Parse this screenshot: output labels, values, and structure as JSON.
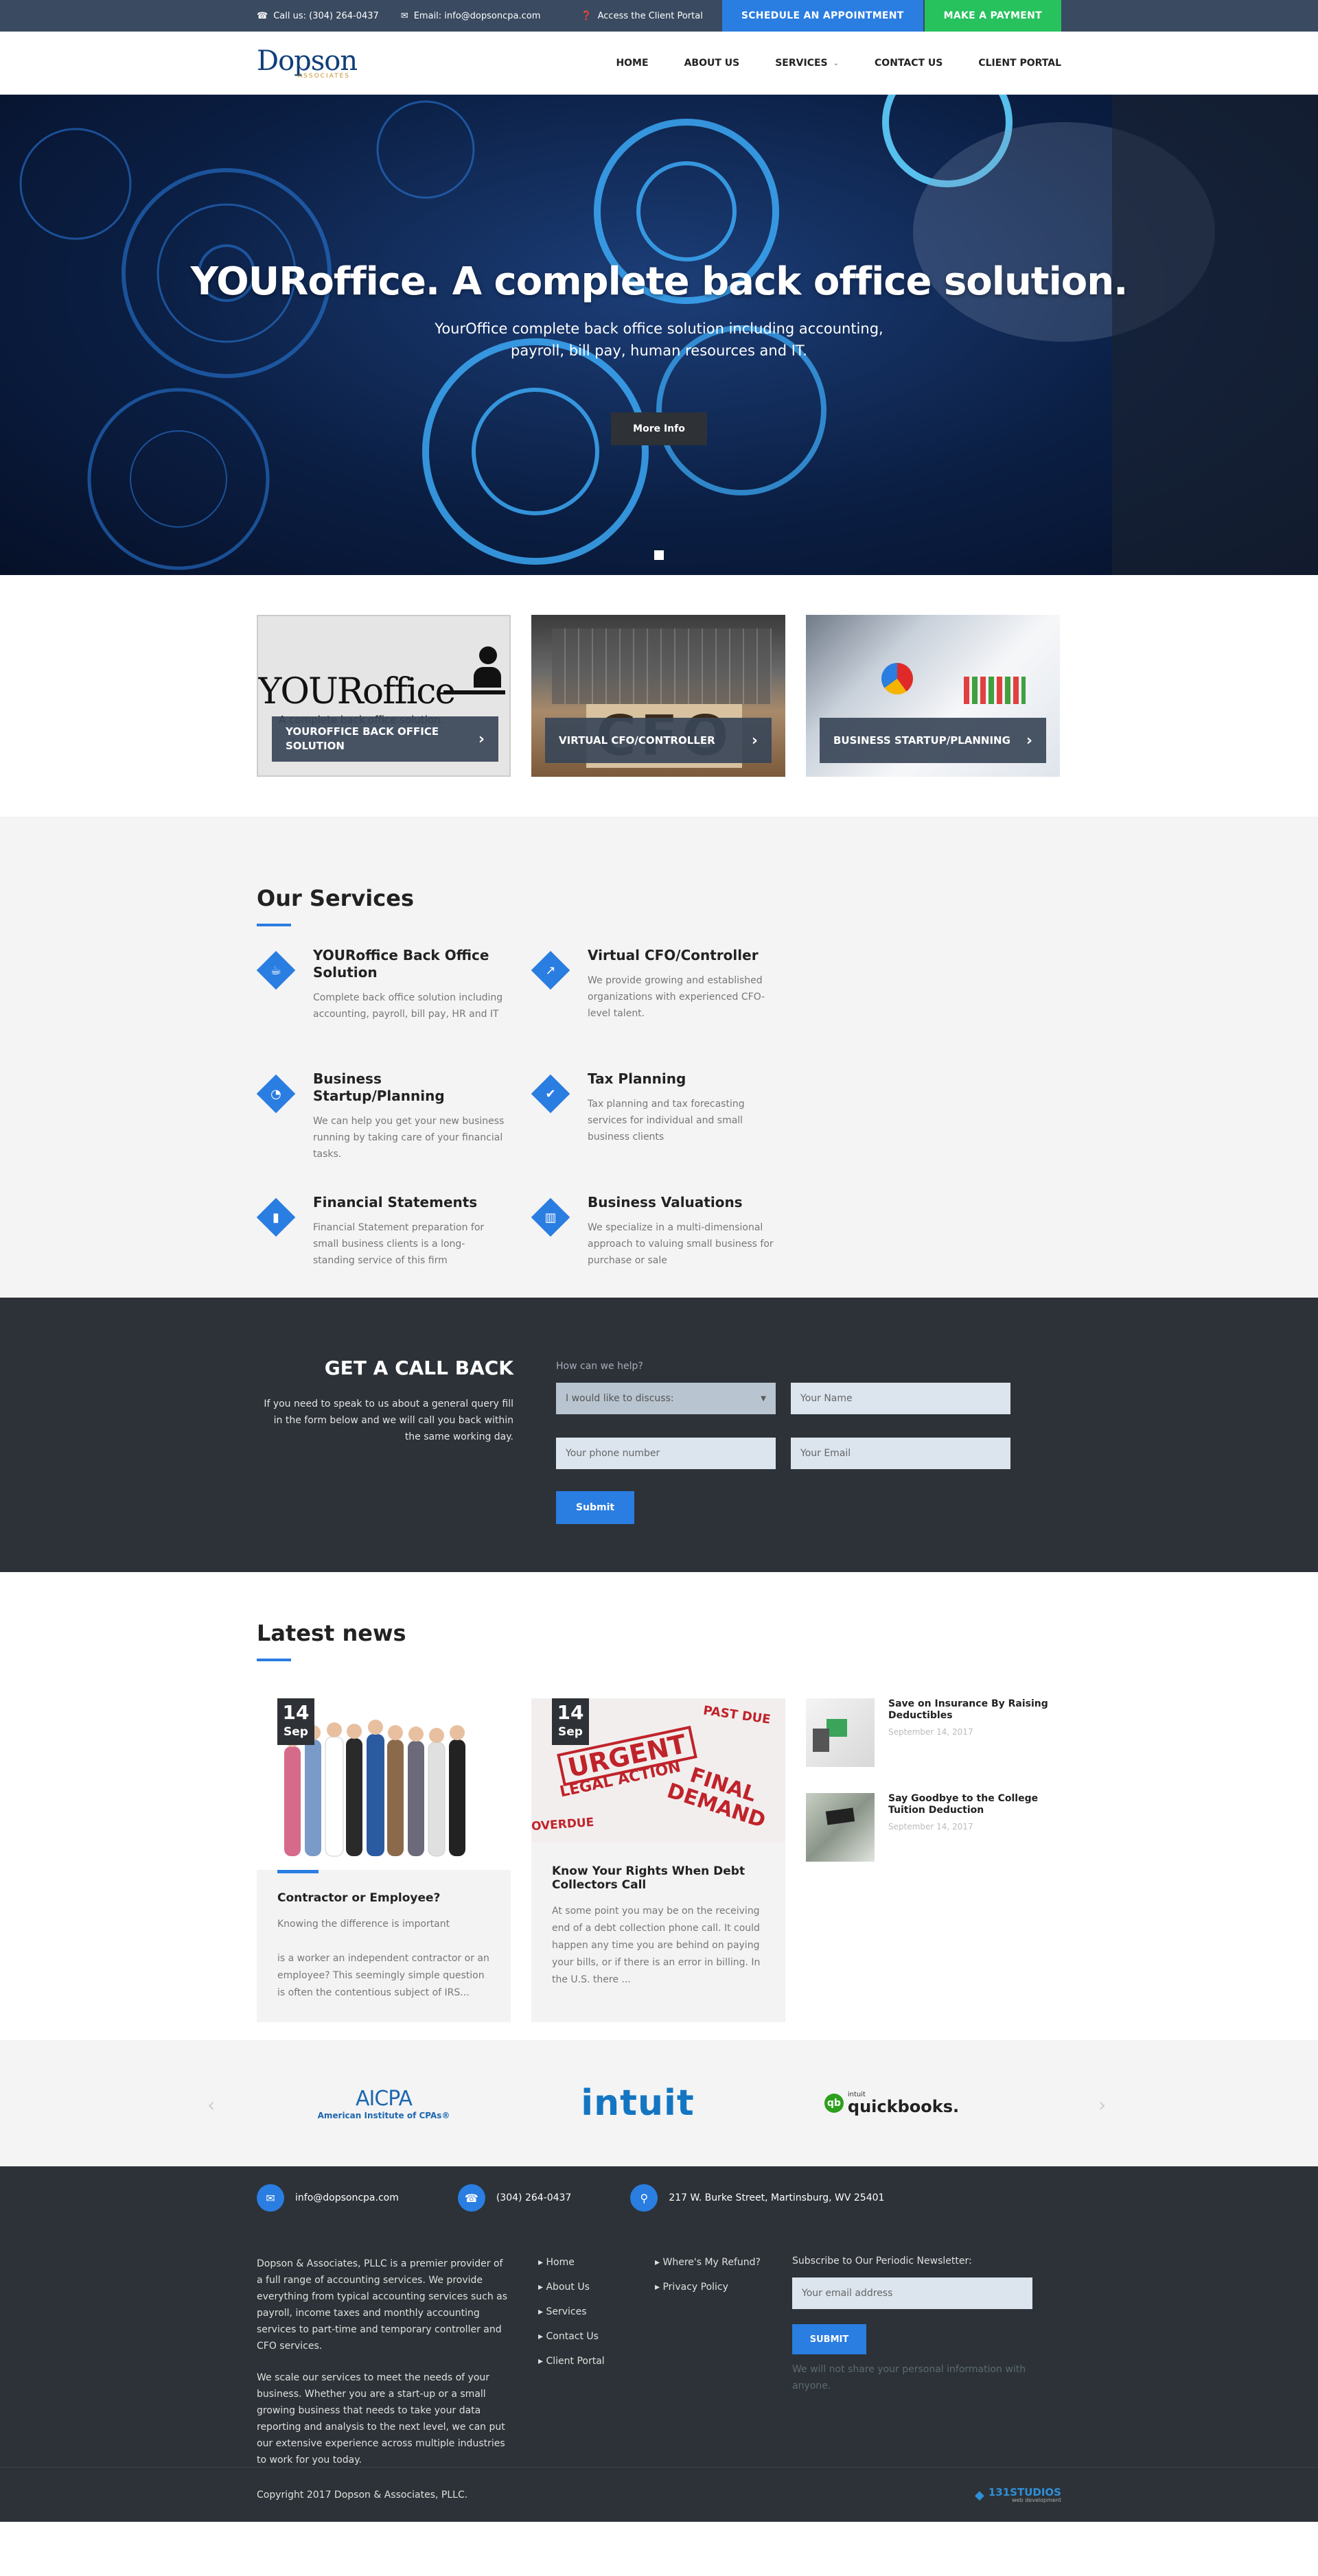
{
  "topbar": {
    "call": "Call us: (304) 264-0437",
    "email": "Email: info@dopsoncpa.com",
    "portal": "Access the Client Portal",
    "schedule": "SCHEDULE AN APPOINTMENT",
    "payment": "MAKE A PAYMENT"
  },
  "logo": {
    "main": "Dopson",
    "sub": "ASSOCIATES"
  },
  "nav": {
    "home": "HOME",
    "about": "ABOUT US",
    "services": "SERVICES",
    "contact": "CONTACT US",
    "portal": "CLIENT PORTAL"
  },
  "hero": {
    "title": "YOURoffice. A complete back office solution.",
    "subtitle": "YourOffice complete back office solution including accounting, payroll, bill pay, human resources and IT.",
    "button": "More Info"
  },
  "cards": [
    {
      "label": "YOUROFFICE BACK OFFICE SOLUTION",
      "img_title": "YOURoffice",
      "img_sub": "A complete back office solution."
    },
    {
      "label": "VIRTUAL CFO/CONTROLLER",
      "img_text": "CFO"
    },
    {
      "label": "BUSINESS STARTUP/PLANNING"
    }
  ],
  "services": {
    "title": "Our Services",
    "items": [
      {
        "title": "YOURoffice Back Office Solution",
        "desc": "Complete back office solution including accounting, payroll, bill pay, HR and IT",
        "icon": "coffee-icon",
        "glyph": "☕"
      },
      {
        "title": "Virtual CFO/Controller",
        "desc": "We provide growing and established organizations with experienced CFO-level talent.",
        "icon": "trending-up-icon",
        "glyph": "↗"
      },
      {
        "title": "Business Startup/Planning",
        "desc": "We can help you get your new business running by taking care of your financial tasks.",
        "icon": "pie-chart-icon",
        "glyph": "◔"
      },
      {
        "title": "Tax Planning",
        "desc": "Tax planning and tax forecasting services for individual and small business clients",
        "icon": "check-circle-icon",
        "glyph": "✔"
      },
      {
        "title": "Financial Statements",
        "desc": "Financial Statement preparation for small business clients is a long-standing service of this firm",
        "icon": "bar-chart-icon",
        "glyph": "▮"
      },
      {
        "title": "Business Valuations",
        "desc": "We specialize in a multi-dimensional approach to valuing small business for purchase or sale",
        "icon": "column-chart-icon",
        "glyph": "▥"
      }
    ]
  },
  "callback": {
    "title": "GET A CALL BACK",
    "text": "If you need to speak to us about a general query fill in the form below and we will call you back within the same working day.",
    "label": "How can we help?",
    "select": "I would like to discuss:",
    "name": "Your Name",
    "phone": "Your phone number",
    "email": "Your Email",
    "submit": "Submit"
  },
  "news": {
    "title": "Latest news",
    "posts": [
      {
        "day": "14",
        "month": "Sep",
        "title": "Contractor or Employee?",
        "text": "Knowing the difference is important\n\nis a worker an independent contractor or an employee? This seemingly simple question is often the contentious subject of IRS..."
      },
      {
        "day": "14",
        "month": "Sep",
        "title": "Know Your Rights When Debt Collectors Call",
        "text": "At some point you may be on the receiving end of a debt collection phone call. It could happen any time you are behind on paying your bills, or if there is an error in billing. In the U.S. there ..."
      }
    ],
    "image_words": [
      "URGENT",
      "LEGAL ACTION",
      "FINAL",
      "DEMAND",
      "PAST DUE",
      "OVERDUE"
    ],
    "side": [
      {
        "title": "Save on Insurance By Raising Deductibles",
        "date": "September 14, 2017"
      },
      {
        "title": "Say Goodbye to the College Tuition Deduction",
        "date": "September 14, 2017"
      }
    ]
  },
  "partners": {
    "aicpa": "AICPA",
    "aicpa_sub": "American Institute of CPAs®",
    "intuit": "intuit",
    "qb_small": "intuit",
    "qb": "quickbooks."
  },
  "footer": {
    "email": "info@dopsoncpa.com",
    "phone": "(304) 264-0437",
    "address": "217 W. Burke Street, Martinsburg, WV 25401",
    "about1": "Dopson & Associates, PLLC is a premier provider of a full range of accounting services. We provide everything from typical accounting services such as payroll, income taxes and monthly accounting services to part-time and temporary controller and CFO services.",
    "about2": "We scale our services to meet the needs of your business. Whether you are a start-up or a small growing business that needs to take your data reporting and analysis to the next level, we can put our extensive experience across multiple industries to work for you today.",
    "links": [
      "Home",
      "About Us",
      "Services",
      "Contact Us",
      "Client Portal"
    ],
    "links2": [
      "Where's My Refund?",
      "Privacy Policy"
    ],
    "newsletter_label": "Subscribe to Our Periodic Newsletter:",
    "newsletter_placeholder": "Your email address",
    "newsletter_button": "SUBMIT",
    "newsletter_note": "We will not share your personal information with anyone.",
    "copyright": "Copyright 2017 Dopson & Associates, PLLC.",
    "studio": "131STUDIOS",
    "studio_sub": "web development"
  },
  "colors": {
    "accent": "#2a7de1",
    "green": "#27c25e",
    "dark": "#2c3237",
    "topbar": "#3a4a60"
  }
}
